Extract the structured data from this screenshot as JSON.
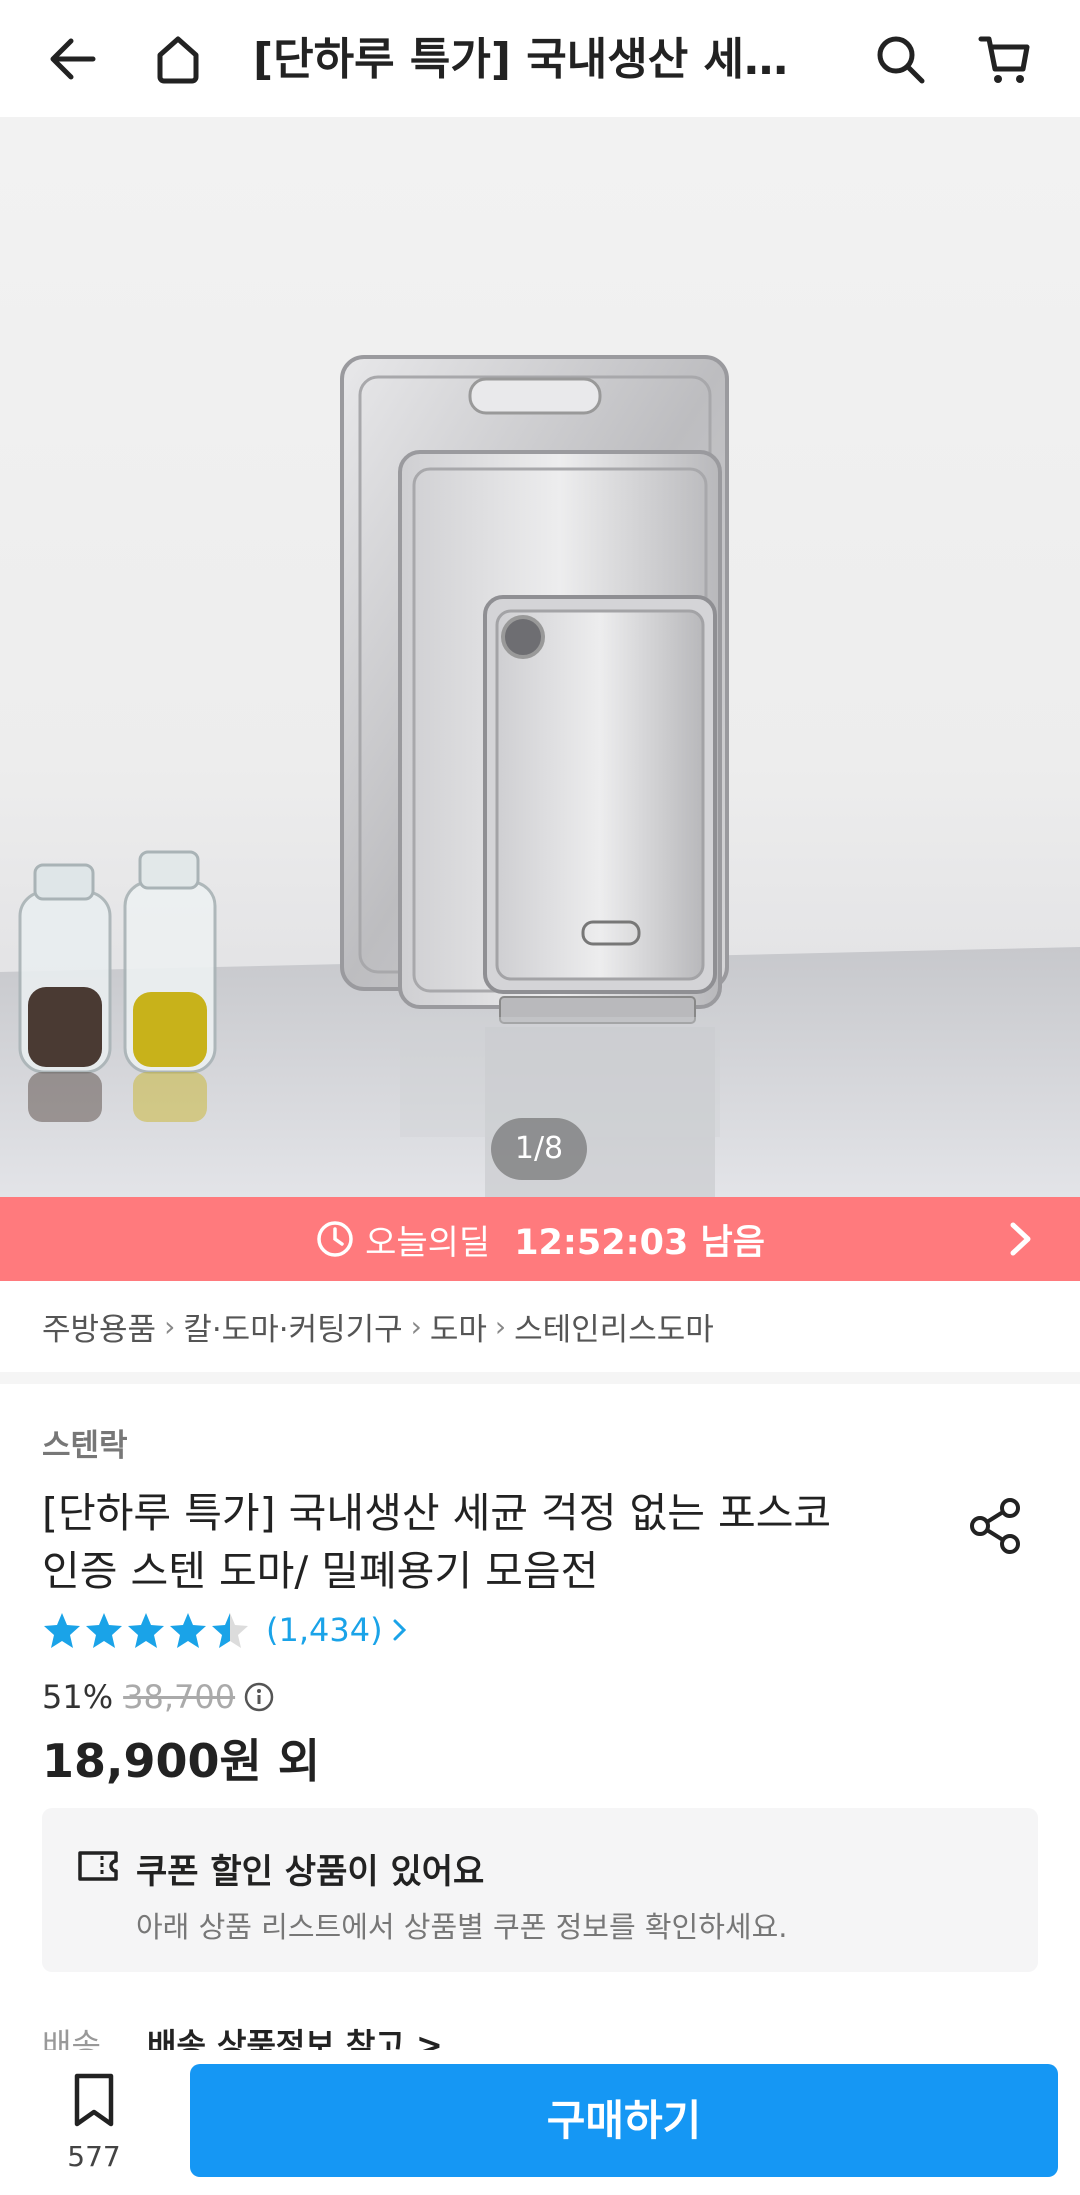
{
  "header": {
    "title": "[단하루 특가] 국내생산 세균 걱정 없는 포스코 인증 스텐 도마/ 밀폐용기 모음전",
    "icons": [
      "back-arrow-icon",
      "home-icon",
      "search-icon",
      "cart-icon"
    ]
  },
  "hero": {
    "pager": "1/8"
  },
  "deal": {
    "label": "오늘의딜",
    "timer": "12:52:03 남음"
  },
  "breadcrumb": [
    "주방용품",
    "칼·도마·커팅기구",
    "도마",
    "스테인리스도마"
  ],
  "product": {
    "brand": "스텐락",
    "title_line1": "[단하루 특가] 국내생산 세균 걱정 없는 포스코",
    "title_line2": "인증 스텐 도마/ 밀폐용기 모음전",
    "rating": 4.5,
    "review_count": "(1,434)",
    "discount": "51%",
    "original_price": "38,700",
    "price": "18,900원 외"
  },
  "coupon": {
    "title": "쿠폰 할인 상품이 있어요",
    "subtitle": "아래 상품 리스트에서 상품별 쿠폰 정보를 확인하세요."
  },
  "shipping": {
    "label": "배송",
    "value": "배송 상품정보 참고 >"
  },
  "bottom": {
    "save_count": "577",
    "buy_label": "구매하기"
  },
  "colors": {
    "deal_banner": "#ff7a7d",
    "accent_blue": "#1597f4",
    "star": "#1aa3e8"
  }
}
